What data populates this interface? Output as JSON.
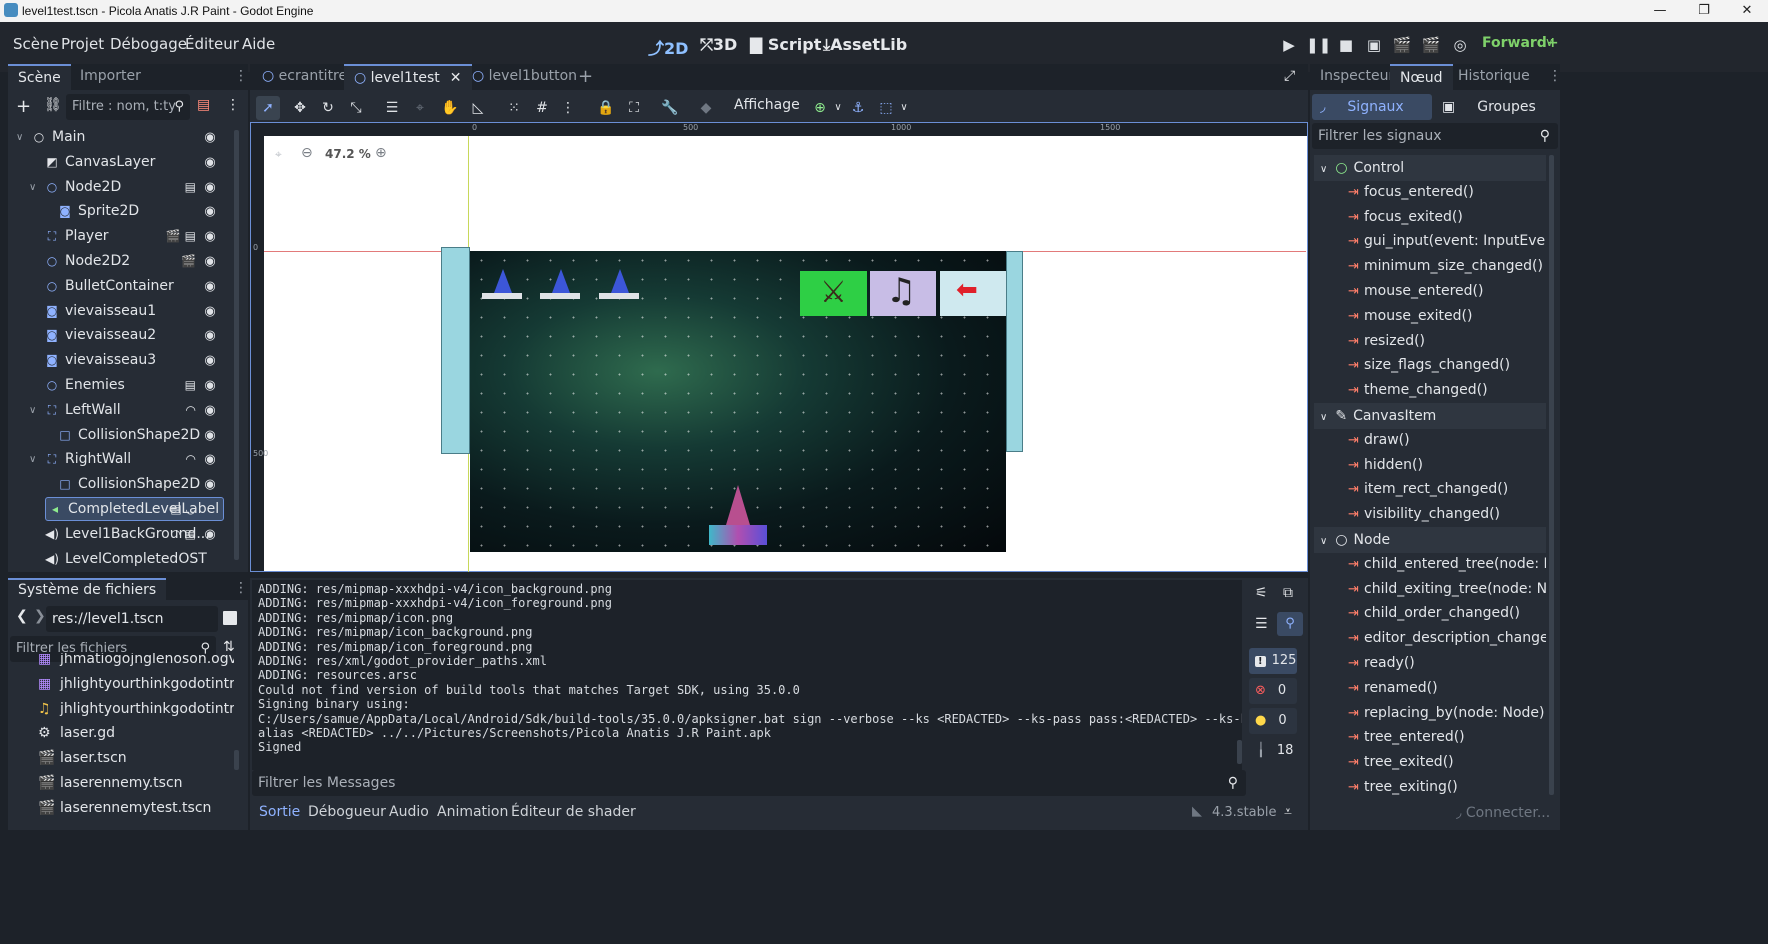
{
  "window": {
    "title": "level1test.tscn - Picola Anatis J.R Paint - Godot Engine"
  },
  "menu": [
    "Scène",
    "Projet",
    "Débogage",
    "Éditeur",
    "Aide"
  ],
  "workspaces": [
    "2D",
    "3D",
    "Script",
    "AssetLib"
  ],
  "renderer": "Forward+",
  "scene_dock": {
    "tabs": [
      "Scène",
      "Importer"
    ],
    "filter_placeholder": "Filtre : nom, t:ty",
    "nodes": [
      {
        "name": "Main",
        "icon": "node-icon",
        "depth": 0,
        "arrow": "∨",
        "badges": ""
      },
      {
        "name": "CanvasLayer",
        "icon": "canvaslayer-icon",
        "depth": 1,
        "arrow": "",
        "badges": ""
      },
      {
        "name": "Node2D",
        "icon": "node2d-icon",
        "depth": 1,
        "arrow": "∨",
        "badges": "▤"
      },
      {
        "name": "Sprite2D",
        "icon": "sprite-icon",
        "depth": 2,
        "arrow": "",
        "badges": ""
      },
      {
        "name": "Player",
        "icon": "body-icon",
        "depth": 1,
        "arrow": "",
        "badges": "🎬 ▤"
      },
      {
        "name": "Node2D2",
        "icon": "node2d-icon",
        "depth": 1,
        "arrow": "",
        "badges": "🎬"
      },
      {
        "name": "BulletContainer",
        "icon": "node2d-icon",
        "depth": 1,
        "arrow": "",
        "badges": ""
      },
      {
        "name": "vievaisseau1",
        "icon": "sprite-icon",
        "depth": 1,
        "arrow": "",
        "badges": ""
      },
      {
        "name": "vievaisseau2",
        "icon": "sprite-icon",
        "depth": 1,
        "arrow": "",
        "badges": ""
      },
      {
        "name": "vievaisseau3",
        "icon": "sprite-icon",
        "depth": 1,
        "arrow": "",
        "badges": ""
      },
      {
        "name": "Enemies",
        "icon": "node2d-icon",
        "depth": 1,
        "arrow": "",
        "badges": "▤"
      },
      {
        "name": "LeftWall",
        "icon": "body-icon",
        "depth": 1,
        "arrow": "∨",
        "badges": "◠"
      },
      {
        "name": "CollisionShape2D",
        "icon": "shape-icon",
        "depth": 2,
        "arrow": "",
        "badges": ""
      },
      {
        "name": "RightWall",
        "icon": "body-icon",
        "depth": 1,
        "arrow": "∨",
        "badges": "◠"
      },
      {
        "name": "CollisionShape2D",
        "icon": "shape-icon",
        "depth": 2,
        "arrow": "",
        "badges": ""
      },
      {
        "name": "CompletedLevelLabel",
        "icon": "label-icon",
        "depth": 1,
        "arrow": "",
        "badges": "▤ ◡"
      },
      {
        "name": "Level1BackGround...",
        "icon": "audio-icon",
        "depth": 1,
        "arrow": "",
        "badges": "◠ ▤"
      },
      {
        "name": "LevelCompletedOST",
        "icon": "audio-icon",
        "depth": 1,
        "arrow": "",
        "badges": ""
      }
    ]
  },
  "filesystem": {
    "title": "Système de fichiers",
    "path": "res://level1.tscn",
    "filter_placeholder": "Filtrer les fichiers",
    "files": [
      "jhmatiogojnglenoson.ogv",
      "jhlightyourthinkgodotintro...",
      "jhlightyourthinkgodotintro...",
      "laser.gd",
      "laser.tscn",
      "laserennemy.tscn",
      "laserennemytest.tscn"
    ]
  },
  "editor_tabs": [
    "ecrantitre",
    "level1test",
    "level1button"
  ],
  "toolbar": {
    "view_label": "Affichage"
  },
  "viewport": {
    "zoom": "47.2 %",
    "ruler": [
      "0",
      "500",
      "1000",
      "1500"
    ],
    "ruler_v": [
      "0",
      "500"
    ]
  },
  "output": {
    "lines": [
      "ADDING: res/mipmap-xxxhdpi-v4/icon_background.png",
      "ADDING: res/mipmap-xxxhdpi-v4/icon_foreground.png",
      "ADDING: res/mipmap/icon.png",
      "ADDING: res/mipmap/icon_background.png",
      "ADDING: res/mipmap/icon_foreground.png",
      "ADDING: res/xml/godot_provider_paths.xml",
      "ADDING: resources.arsc",
      "Could not find version of build tools that matches Target SDK, using 35.0.0",
      "Signing binary using:",
      "C:/Users/samue/AppData/Local/Android/Sdk/build-tools/35.0.0/apksigner.bat sign --verbose --ks <REDACTED> --ks-pass pass:<REDACTED> --ks-key-",
      "alias <REDACTED> ../../Pictures/Screenshots/Picola Anatis J.R Paint.apk",
      "Signed"
    ],
    "filter_placeholder": "Filtrer les Messages",
    "counts": {
      "messages": "125",
      "errors": "0",
      "warnings": "0",
      "other": "18"
    }
  },
  "bottom_tabs": [
    "Sortie",
    "Débogueur",
    "Audio",
    "Animation",
    "Éditeur de shader"
  ],
  "version": "4.3.stable",
  "inspector": {
    "tabs": [
      "Inspecteur",
      "Nœud",
      "Historique"
    ],
    "subtabs": [
      "Signaux",
      "Groupes"
    ],
    "filter_placeholder": "Filtrer les signaux",
    "sections": [
      {
        "name": "Control",
        "signals": [
          "focus_entered()",
          "focus_exited()",
          "gui_input(event: InputEvent)",
          "minimum_size_changed()",
          "mouse_entered()",
          "mouse_exited()",
          "resized()",
          "size_flags_changed()",
          "theme_changed()"
        ]
      },
      {
        "name": "CanvasItem",
        "signals": [
          "draw()",
          "hidden()",
          "item_rect_changed()",
          "visibility_changed()"
        ]
      },
      {
        "name": "Node",
        "signals": [
          "child_entered_tree(node: No...",
          "child_exiting_tree(node: Node)",
          "child_order_changed()",
          "editor_description_changed(...",
          "ready()",
          "renamed()",
          "replacing_by(node: Node)",
          "tree_entered()",
          "tree_exited()",
          "tree_exiting()"
        ]
      }
    ],
    "connect_label": "Connecter..."
  }
}
